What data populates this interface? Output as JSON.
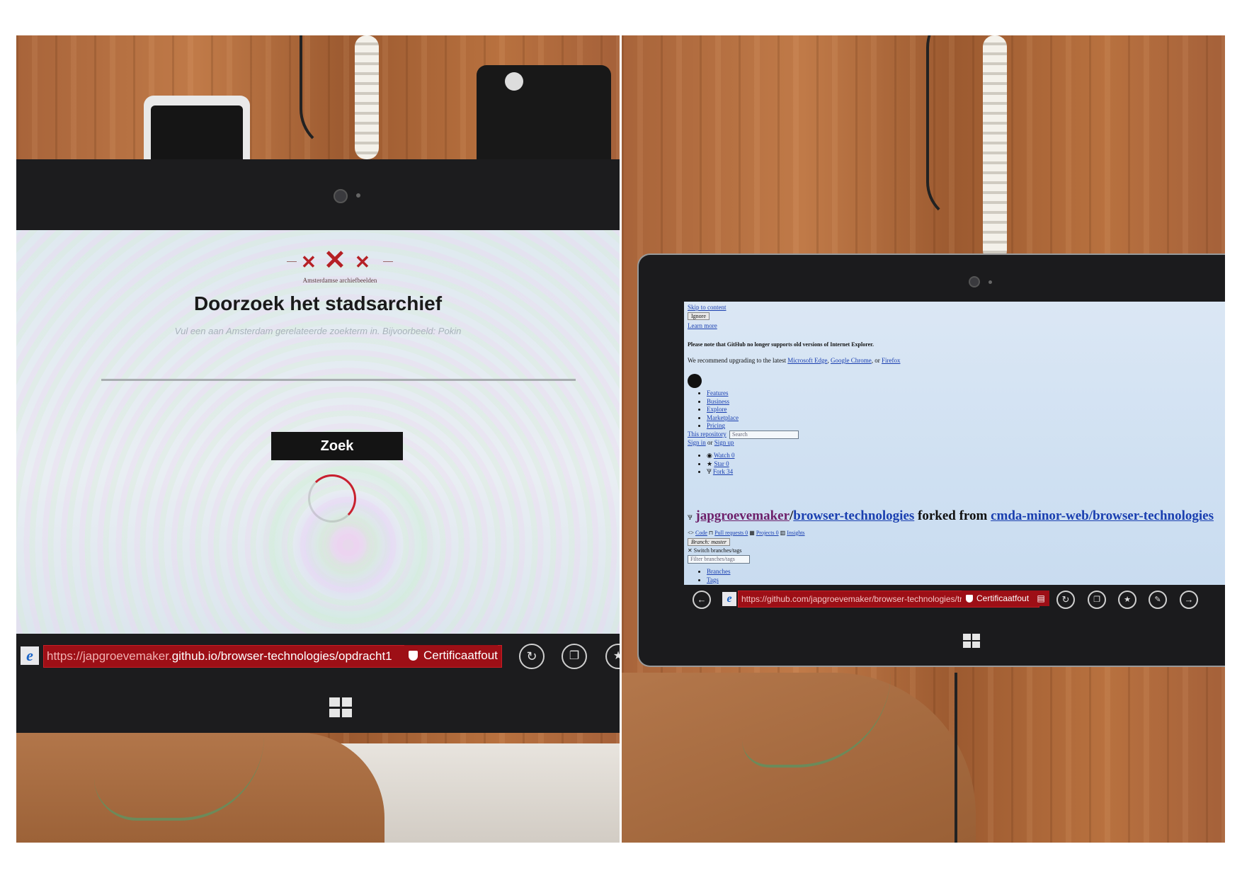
{
  "left_photo": {
    "page": {
      "logo_caption": "Amsterdamse archiefbeelden",
      "title": "Doorzoek het stadsarchief",
      "search_placeholder": "Vul een aan Amsterdam gerelateerde zoekterm in. Bijvoorbeeld: Pokin",
      "search_button": "Zoek"
    },
    "browser": {
      "url_prefix": "https://japgroevemaker.",
      "url_rest": "github.io/browser-technologies/opdracht1",
      "cert_label": "Certificaatfout"
    }
  },
  "right_photo": {
    "page": {
      "skip_link": "Skip to content",
      "ignore_button": "Ignore",
      "learn_more": "Learn more",
      "notice": "Please note that GitHub no longer supports old versions of Internet Explorer.",
      "recommend_text": "We recommend upgrading to the latest",
      "recommend_links": [
        "Microsoft Edge",
        "Google Chrome",
        "Firefox"
      ],
      "recommend_sep": ", ",
      "recommend_or": ", or ",
      "nav_items": [
        "Features",
        "Business",
        "Explore",
        "Marketplace",
        "Pricing"
      ],
      "this_repository": "This repository",
      "search_placeholder": "Search",
      "sign_in": "Sign in",
      "or": " or ",
      "sign_up": "Sign up",
      "repo_actions": [
        "Watch 0",
        "Star 0",
        "Fork 34"
      ],
      "repo_owner": "japgroevemaker",
      "repo_slash": "/",
      "repo_name": "browser-technologies",
      "forked_from_text": " forked from ",
      "forked_from_repo": "cmda-minor-web/browser-technologies",
      "tabs": [
        "Code",
        "Pull requests 0",
        "Projects 0",
        "Insights"
      ],
      "branch_button": "Branch: master",
      "switch_branches": "Switch branches/tags",
      "filter_placeholder": "Filter branches/tags",
      "branch_items": [
        "Branches",
        "Tags"
      ]
    },
    "browser": {
      "url": "https://github.com/japgroevemaker/browser-technologies/tree",
      "cert_label": "Certificaatfout"
    }
  },
  "icons": {
    "back": "back-arrow-icon",
    "refresh": "refresh-icon",
    "tabs": "tabs-icon",
    "favorite": "star-icon",
    "tools": "wrench-icon",
    "forward": "forward-arrow-icon",
    "windows": "windows-logo-icon"
  },
  "colors": {
    "cert_error_red": "#9d0f16",
    "logo_red": "#b52025",
    "link_blue": "#1a3fb0"
  }
}
